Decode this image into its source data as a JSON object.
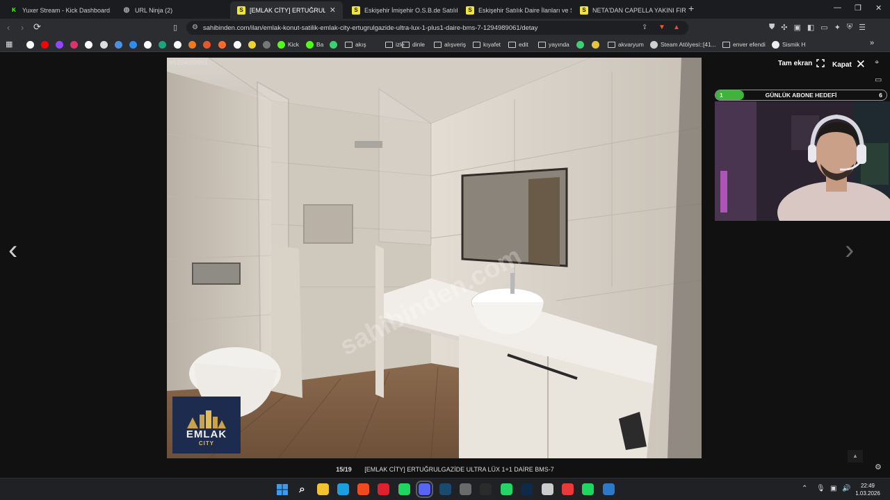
{
  "browser": {
    "tabs": [
      {
        "title": "Yuxer Stream - Kick Dashboard",
        "favicon": "kick-icon",
        "active": false
      },
      {
        "title": "URL Ninja (2)",
        "favicon": "ninja-icon",
        "active": false
      },
      {
        "title": "[EMLAK CİTY] ERTUĞRULGAZİDE",
        "favicon": "sahibinden-icon",
        "active": true
      },
      {
        "title": "Eskişehir İmişehir O.S.B.de Satılık Fab",
        "favicon": "sahibinden-icon",
        "active": false
      },
      {
        "title": "Eskişehir Satılık Daire İlanları ve Satılık",
        "favicon": "sahibinden-icon",
        "active": false
      },
      {
        "title": "NETA'DAN CAPELLA YAKINI FIRSAT D",
        "favicon": "sahibinden-icon",
        "active": false
      }
    ],
    "new_tab": "+",
    "url": "sahibinden.com/ilan/emlak-konut-satilik-emlak-city-ertugrulgazide-ultra-lux-1-plus1-daire-bms-7-1294989061/detay",
    "bookmarks": [
      {
        "label": "",
        "icon": "google-icon",
        "color": "#ffffff"
      },
      {
        "label": "",
        "icon": "youtube-icon",
        "color": "#ff0000"
      },
      {
        "label": "",
        "icon": "twitch-icon",
        "color": "#9146ff"
      },
      {
        "label": "",
        "icon": "instagram-icon",
        "color": "#e1306c"
      },
      {
        "label": "",
        "icon": "x-icon",
        "color": "#ffffff"
      },
      {
        "label": "",
        "icon": "github-icon",
        "color": "#dddddd"
      },
      {
        "label": "",
        "icon": "cloud-icon",
        "color": "#4a90e2"
      },
      {
        "label": "",
        "icon": "play-icon",
        "color": "#2f8cf0"
      },
      {
        "label": "",
        "icon": "w-icon",
        "color": "#ffffff"
      },
      {
        "label": "",
        "icon": "misc-icon",
        "color": "#1ea37a"
      },
      {
        "label": "",
        "icon": "disk-icon",
        "color": "#ffffff"
      },
      {
        "label": "",
        "icon": "hb-icon",
        "color": "#f27a1a"
      },
      {
        "label": "",
        "icon": "circle-icon",
        "color": "#e05a2b"
      },
      {
        "label": "",
        "icon": "m-icon",
        "color": "#ff6a2b"
      },
      {
        "label": "",
        "icon": "amazon-icon",
        "color": "#ffffff"
      },
      {
        "label": "",
        "icon": "note-icon",
        "color": "#f2d22e"
      },
      {
        "label": "",
        "icon": "bird-icon",
        "color": "#777777"
      },
      {
        "label": "Kick",
        "icon": "kick-icon",
        "color": "#53fc18"
      },
      {
        "label": "Ba",
        "icon": "kick-icon",
        "color": "#53fc18"
      },
      {
        "label": "",
        "icon": "green-circle-icon",
        "color": "#3cd070"
      },
      {
        "label": "akış",
        "icon": "folder-icon",
        "color": "#cfcfcf"
      },
      {
        "label": "izle",
        "icon": "folder-icon",
        "color": "#cfcfcf"
      },
      {
        "label": "dinle",
        "icon": "folder-icon",
        "color": "#cfcfcf"
      },
      {
        "label": "alışveriş",
        "icon": "folder-icon",
        "color": "#cfcfcf"
      },
      {
        "label": "kıyafet",
        "icon": "folder-icon",
        "color": "#cfcfcf"
      },
      {
        "label": "edit",
        "icon": "folder-icon",
        "color": "#cfcfcf"
      },
      {
        "label": "yayında",
        "icon": "folder-icon",
        "color": "#cfcfcf"
      },
      {
        "label": "",
        "icon": "q-icon",
        "color": "#3cd070"
      },
      {
        "label": "",
        "icon": "yellow-icon",
        "color": "#e8c43a"
      },
      {
        "label": "akvaryum",
        "icon": "folder-icon",
        "color": "#cfcfcf"
      },
      {
        "label": "Steam Atölyesi::[41...",
        "icon": "steam-icon",
        "color": "#cfcfcf"
      },
      {
        "label": "enver efendi",
        "icon": "folder-icon",
        "color": "#cfcfcf"
      },
      {
        "label": "Sismik H",
        "icon": "globe-icon",
        "color": "#eeeeee"
      }
    ]
  },
  "viewer": {
    "photo_id": "#1294989061",
    "watermark": "sahibinden.com",
    "logo_text": "EMLAK",
    "logo_sub": "CITY",
    "fullscreen_label": "Tam ekran",
    "close_label": "Kapat",
    "counter": "15/19",
    "caption": "[EMLAK CİTY] ERTUĞRULGAZİDE ULTRA LÜX 1+1 DAİRE BMS-7",
    "prev_arrow": "‹",
    "next_arrow": "›"
  },
  "overlay": {
    "goal_title": "GÜNLÜK ABONE HEDEFİ",
    "goal_current": "1",
    "goal_target": "6",
    "goal_progress": 0.166,
    "goal_color": "#3fb33b"
  },
  "taskbar": {
    "time": "22:49",
    "date": "1.03.2026",
    "icons": [
      {
        "name": "windows-start-icon",
        "color": "#3a9bf0"
      },
      {
        "name": "search-icon",
        "color": "#dddddd"
      },
      {
        "name": "file-explorer-icon",
        "color": "#f2c230"
      },
      {
        "name": "edge-icon",
        "color": "#1aa0e0"
      },
      {
        "name": "brave-icon",
        "color": "#f04b1e"
      },
      {
        "name": "opera-icon",
        "color": "#e0202c"
      },
      {
        "name": "spotify-icon",
        "color": "#1ed760"
      },
      {
        "name": "discord-icon",
        "color": "#5865f2"
      },
      {
        "name": "steam-icon",
        "color": "#1b4a70"
      },
      {
        "name": "calculator-icon",
        "color": "#6a6a6a"
      },
      {
        "name": "epic-games-icon",
        "color": "#2b2b2b"
      },
      {
        "name": "whatsapp-icon",
        "color": "#25d366"
      },
      {
        "name": "photoshop-icon",
        "color": "#0d2a4a"
      },
      {
        "name": "chrome-icon",
        "color": "#cccccc"
      },
      {
        "name": "app-icon",
        "color": "#e83a3a"
      },
      {
        "name": "spotify-alt-icon",
        "color": "#1ed760"
      },
      {
        "name": "settings-app-icon",
        "color": "#2b79c8"
      }
    ]
  }
}
